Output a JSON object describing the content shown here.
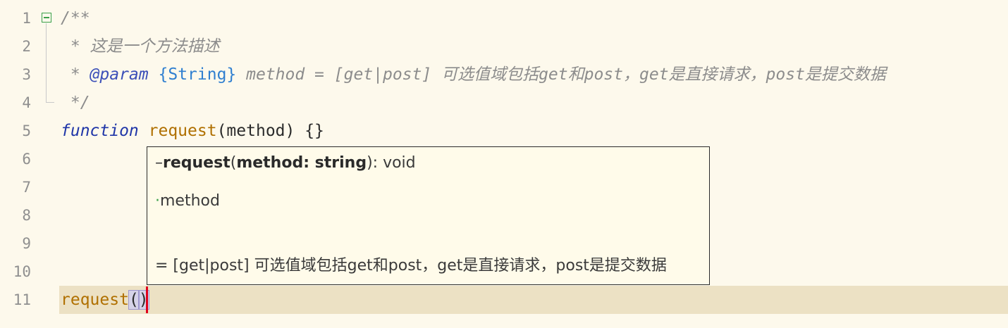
{
  "editor": {
    "line_numbers": [
      "1",
      "2",
      "3",
      "4",
      "5",
      "6",
      "7",
      "8",
      "9",
      "10",
      "11"
    ],
    "lines": {
      "l1": "/**",
      "l2": " * 这是一个方法描述",
      "l3_prefix": " * ",
      "l3_tag": "@param",
      "l3_sp1": " ",
      "l3_type": "{String}",
      "l3_rest": " method = [get|post] 可选值域包括get和post，get是直接请求，post是提交数据",
      "l4": " */",
      "l5_kw": "function",
      "l5_sp": " ",
      "l5_fn": "request",
      "l5_rest": "(method) {}",
      "l11_fn": "request",
      "l11_open": "(",
      "l11_close": ")"
    }
  },
  "popup": {
    "sig_dash": "–",
    "sig_name": "request",
    "sig_open": "(",
    "sig_param": "method: string",
    "sig_close": "): void",
    "param_dot": "·",
    "param_name": "method",
    "description": "= [get|post] 可选值域包括get和post，get是直接请求，post是提交数据"
  },
  "colors": {
    "background": "#fdf9ec",
    "current_line": "#ece1c4",
    "comment": "#8c8c8c",
    "keyword": "#2036a8",
    "function_name": "#b07000",
    "caret": "#e0001c"
  }
}
